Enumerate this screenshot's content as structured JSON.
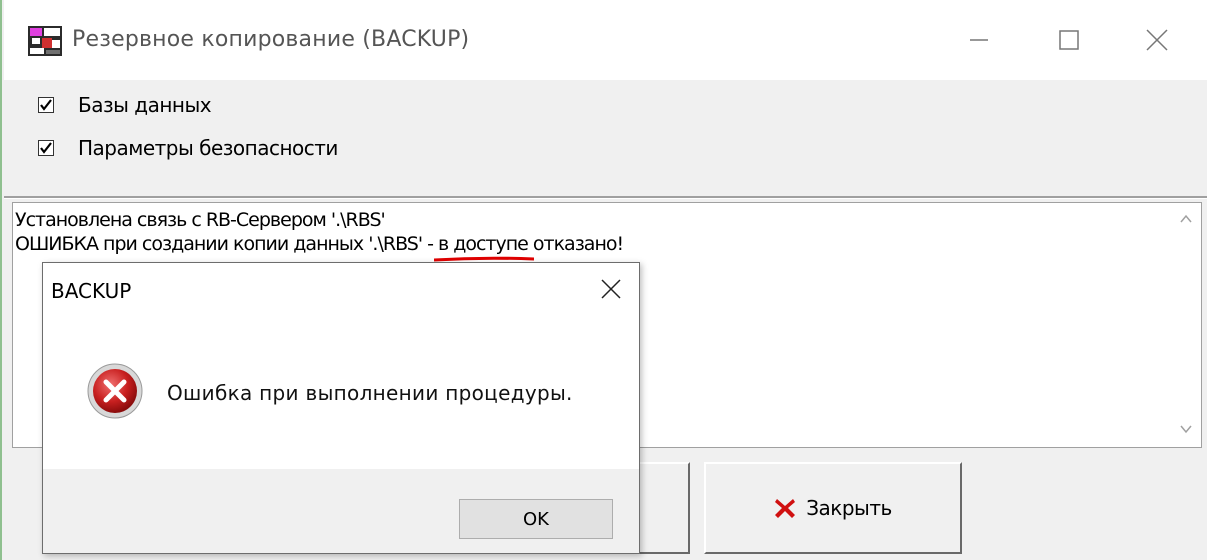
{
  "window": {
    "title": "Резервное копирование (BACKUP)"
  },
  "options": [
    {
      "label": "Базы данных",
      "checked": true
    },
    {
      "label": "Параметры безопасности",
      "checked": true
    }
  ],
  "log": {
    "line1": "Установлена связь с RB-Сервером '.\\RBS'",
    "line2_prefix": "ОШИБКА при создании копии данных '.\\RBS' - ",
    "line2_error": "в доступе отказано!",
    "highlight_color": "#e00000"
  },
  "buttons": {
    "close_label": "Закрыть"
  },
  "dialog": {
    "title": "BACKUP",
    "message": "Ошибка при выполнении процедуры.",
    "ok_label": "OK",
    "icon": "error-icon"
  }
}
